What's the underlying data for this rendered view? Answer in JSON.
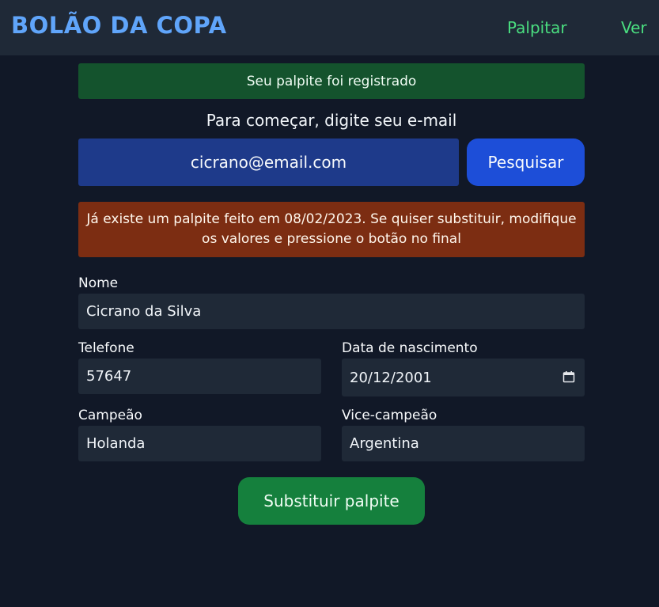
{
  "header": {
    "brand": "BOLÃO DA COPA",
    "nav": [
      {
        "label": "Palpitar"
      },
      {
        "label": "Ver"
      }
    ]
  },
  "alerts": {
    "success": "Seu palpite foi registrado",
    "warning": "Já existe um palpite feito em 08/02/2023. Se quiser substituir, modifique os valores e pressione o botão no final"
  },
  "search": {
    "prompt": "Para começar, digite seu e-mail",
    "email_value": "cicrano@email.com",
    "button_label": "Pesquisar"
  },
  "form": {
    "nome": {
      "label": "Nome",
      "value": "Cicrano da Silva"
    },
    "telefone": {
      "label": "Telefone",
      "value": "57647"
    },
    "nascimento": {
      "label": "Data de nascimento",
      "value": "20/12/2001"
    },
    "campeao": {
      "label": "Campeão",
      "value": "Holanda"
    },
    "vice": {
      "label": "Vice-campeão",
      "value": "Argentina"
    },
    "submit_label": "Substituir palpite"
  },
  "colors": {
    "background": "#111827",
    "brand": "#60a5fa",
    "nav_link": "#4ade80",
    "success": "#14532d",
    "warning": "#7c2d12",
    "primary_button": "#1d4ed8",
    "submit_button": "#15803d"
  },
  "icons": {
    "date_picker": "calendar-icon"
  }
}
